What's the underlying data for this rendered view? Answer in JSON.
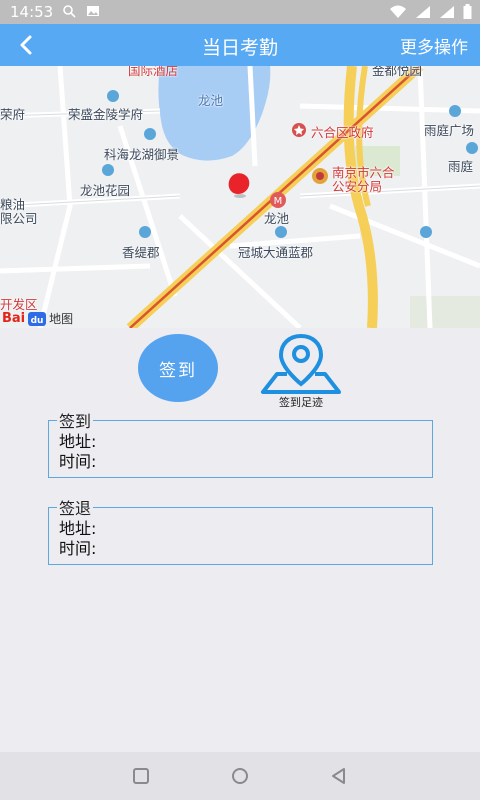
{
  "status_bar": {
    "time": "14:53"
  },
  "header": {
    "title": "当日考勤",
    "more_actions": "更多操作"
  },
  "map": {
    "labels": {
      "guoji": "国际酒店",
      "jindu": "金都悦园",
      "rongfu": "荣府",
      "rongsheng": "荣盛金陵学府",
      "longchi_lake": "龙池",
      "liuhe_gov": "六合区政府",
      "yuting1": "雨庭广场",
      "yuting2": "雨庭",
      "kehai": "科海龙湖御景",
      "nanjing_police": "南京市六合",
      "nanjing_police2": "公安分局",
      "longchi_garden": "龙池花园",
      "liangyou": "粮油",
      "liangyou2": "限公司",
      "longchi_station": "龙池",
      "xiangti": "香缇郡",
      "guancheng": "冠城大通蓝郡",
      "kaifa": "开发区",
      "baidu_logo": "Bai",
      "baidu_logo2": "地图"
    }
  },
  "actions": {
    "sign_in": "签到",
    "footprint": "签到足迹"
  },
  "records": {
    "sign_in": {
      "title": "签到",
      "address_label": "地址:",
      "time_label": "时间:"
    },
    "sign_out": {
      "title": "签退",
      "address_label": "地址:",
      "time_label": "时间:"
    }
  },
  "colors": {
    "accent": "#58a9f3",
    "button": "#55a2ef",
    "box_border": "#5ea8de"
  },
  "icons": [
    "back-icon",
    "location-pin-icon",
    "wifi-icon",
    "battery-icon",
    "square-nav-icon",
    "circle-nav-icon",
    "triangle-back-nav-icon"
  ]
}
